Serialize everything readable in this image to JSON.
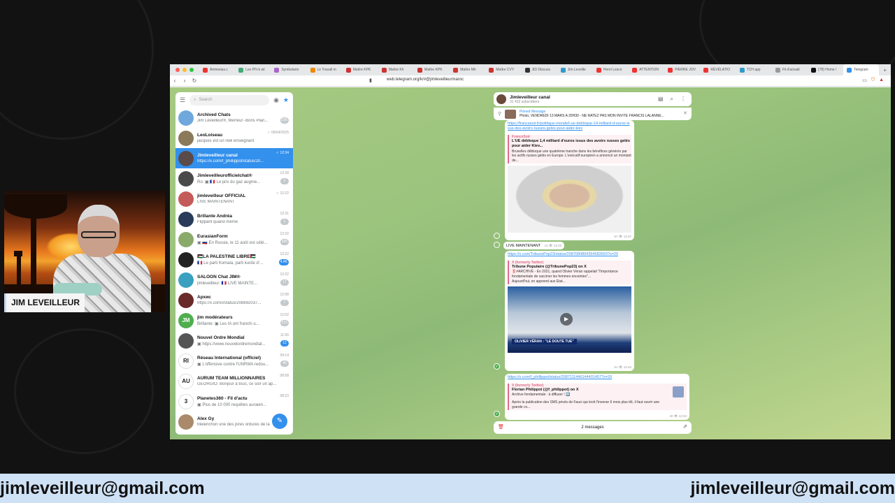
{
  "stream": {
    "name_tag": "JIM LEVEILLEUR",
    "email_left": "jimleveilleur@gmail.com",
    "email_right": "jimleveilleur@gmail.com"
  },
  "browser": {
    "tabs": [
      "Amnesias.c",
      "Les Pl'n's wt",
      "Symbolario",
      "Le Travail m",
      "Maître KPK",
      "Maître Kh",
      "Maître KPK",
      "Maître Mh",
      "Maître CVY",
      "JID Discuss",
      "Jim Leveille",
      "Henri Lesco",
      "ATTENTION",
      "PIERRE JOV",
      "RÉVÉLATIO",
      "TCH app",
      "Fil d'actuali",
      "(78) Home /",
      "Telegram"
    ],
    "url": "web.telegram.org/k/#@jimleveilleurmaroc"
  },
  "sidebar": {
    "search_placeholder": "Search",
    "chats": [
      {
        "name": "Archived Chats",
        "preview": "Jim Leveilleur®, Merreur -Bons Plan...",
        "time": "",
        "badge": "236",
        "color": "#6fa8dc",
        "initials": ""
      },
      {
        "name": "LeoLoiseau",
        "preview": "jacques est un réel enseignant",
        "time": "✓ 09/04/2025",
        "badge": "",
        "color": "#8a7a5a",
        "initials": ""
      },
      {
        "name": "Jimleveilleur canal",
        "preview": "https://x.com/f_phillippot/status/20...",
        "time": "✓ 12:34",
        "badge": "",
        "color": "#5a4a4a",
        "initials": "",
        "active": true
      },
      {
        "name": "Jimleveilleurofficielchat®",
        "preview": "Ro: ▣ 🇫🇷 Le prix du gaz augme...",
        "time": "12:28",
        "badge": "2",
        "color": "#4a4a4a",
        "initials": ""
      },
      {
        "name": "jimleveilleur OFFICIAL",
        "preview": "LIVE MAINTENANT",
        "time": "✓ 12:22",
        "badge": "",
        "color": "#c45a5a",
        "initials": ""
      },
      {
        "name": "Brillante Andréa",
        "preview": "Flippant quand même",
        "time": "12:31",
        "badge": "1",
        "color": "#2a3a5a",
        "initials": ""
      },
      {
        "name": "EurasianForm",
        "preview": "▣ 🇷🇺 En Russie, le 11 août est célé...",
        "time": "12:22",
        "badge": "295",
        "color": "#8aaa6a",
        "initials": ""
      },
      {
        "name": "🇵🇸LA PALESTINE LIBRE🇵🇸",
        "preview": "🇫🇷 Le parti Komala, parti kurde d'...",
        "time": "12:22",
        "badge": "4.4K",
        "color": "#222222",
        "initials": ""
      },
      {
        "name": "SALOON Chat JIM®",
        "preview": "jimleveilleur: 🇫🇷 LIVE MAINTE...",
        "time": "12:22",
        "badge": "17",
        "color": "#3aa0c0",
        "initials": ""
      },
      {
        "name": "Архис",
        "preview": "https://x.com/i/status/208692037...",
        "time": "12:08",
        "badge": "7",
        "color": "#6a2a2a",
        "initials": ""
      },
      {
        "name": "jim modérateurs",
        "preview": "Brillante: ▣ Les IA ont franchi u...",
        "time": "12:02",
        "badge": "215",
        "color": "#4fae4e",
        "initials": "JM"
      },
      {
        "name": "Nouvel Ordre Mondial",
        "preview": "▣ https://www.nouvelordremondial...",
        "time": "11:56",
        "badge": "12",
        "color": "#555555",
        "initials": ""
      },
      {
        "name": "Réseau International (officiel)",
        "preview": "▣ L'offensive contre l'UNRWA redou...",
        "time": "09:14",
        "badge": "40",
        "color": "#ffffff",
        "initials": "RI"
      },
      {
        "name": "AURUM TEAM MILLIONNAIRES",
        "preview": "GEORGIO: Bonjour à tous, ce soir un ap...",
        "time": "08:58",
        "badge": "",
        "color": "#ffffff",
        "initials": "AU"
      },
      {
        "name": "Planetes360 - Fil d'actu",
        "preview": "▣ Plus de 10 000 requêtes auraien...",
        "time": "08:23",
        "badge": "",
        "color": "#ffffff",
        "initials": "3"
      },
      {
        "name": "Alex Gy",
        "preview": "Melenchon une des pires ordures de la",
        "time": "",
        "badge": "",
        "color": "#aa8a6a",
        "initials": ""
      }
    ]
  },
  "chat": {
    "title": "Jimleveilleur canal",
    "subscribers": "31 422 subscribers",
    "pinned_label": "Pinned Message",
    "pinned_text": "Photo, VENDREDI 13 MARS A 20H30 - NE RATEZ PAS MON INVITÉ FRANCIS LALANNE...",
    "msg1": {
      "link": "https://francesoir.fr/politique-monde/l-ue-debloque-14-milliard-d-euros-issus-des-avoirs-russes-geles-pour-aider-kiev",
      "site": "FranceSoir",
      "title": "L'UE débloque 1,4 milliard d'euros issus des avoirs russes gelés pour aider Kiev...",
      "desc": "Bruxelles débloque une quatrième tranche dans les bénéfices générés par les actifs russes gelés en Europe. L'exécutif européen a annoncé un montant de...",
      "meta": "57 👁 12:37"
    },
    "live": "LIVE MAINTENANT",
    "live_meta": "14 👁 12:22",
    "msg2": {
      "link": "https://x.com/TribunePop23/status/2087084894354583693?s=20",
      "site": "X (formerly Twitter)",
      "title": "Tribune Populaire (@TribunePop23) on X",
      "desc": "‼️#ARCHIVE - En 2021, quand Olivier Véran rappelait \"l'importance fondamentale de vacciner les femmes enceintes\"...",
      "desc2": "Aujourd'hui, on apprend aux Etat...",
      "video_caption": "OLIVIER VÉRAN : \"LE DOUTE TUE\"",
      "meta": "51 👁 12:34"
    },
    "msg3": {
      "link": "https://x.com/f_phillippot/status/2087111446144401457?s=20",
      "site": "X (formerly Twitter)",
      "title": "Florian Philippot (@f_philippot) on X",
      "desc": "Archive fondamentale : à diffuser ! 🔟",
      "desc2": "Après la publication des SMS privés de Fauci qui écrit l'inverse 6 mois plus tôt, il faut ouvrir une grande co...",
      "meta": "40 👁 12:34"
    },
    "selection": "2 messages"
  }
}
